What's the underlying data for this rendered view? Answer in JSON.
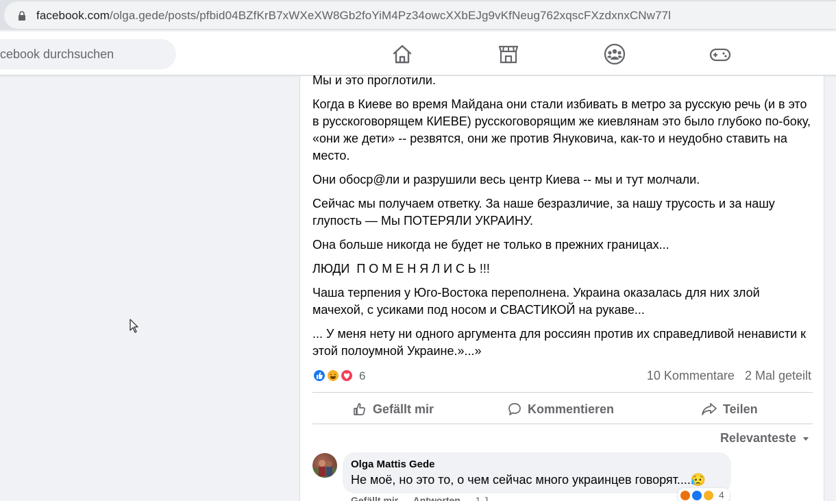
{
  "browser": {
    "url_host": "facebook.com",
    "url_path": "/olga.gede/posts/pfbid04BZfKrB7xWXeXW8Gb2foYiM4Pz34owcXXbEJg9vKfNeug762xqscFXzdxnxCNw77l"
  },
  "header": {
    "search_placeholder": "Facebook durchsuchen",
    "search_visible_text": "cebook durchsuchen",
    "nav": [
      {
        "icon": "home-icon"
      },
      {
        "icon": "marketplace-icon"
      },
      {
        "icon": "groups-icon"
      },
      {
        "icon": "gaming-icon"
      }
    ]
  },
  "post": {
    "paragraphs": [
      "Мы и это проглотили.",
      "Когда в Киеве во время Майдана они стали избивать в метро за русскую речь (и в это в русскоговорящем КИЕВЕ) русскоговорящим же киевлянам это было глубоко по-боку, «они же дети» -- резвятся, они же против Януковича, как-то и неудобно ставить на место.",
      "Они обоср@ли и разрушили весь центр Киева -- мы и тут молчали.",
      "Сейчас мы получаем ответку. За наше безразличие, за нашу трусость и за нашу глупость — Мы ПОТЕРЯЛИ УКРАИНУ.",
      "Она больше никогда не будет не только в прежних границах...",
      "ЛЮДИ  П О М Е Н Я Л И С Ь !!!",
      "Чаша терпения у Юго-Востока переполнена. Украина оказалась для них злой мачехой, с усиками под носом и СВАСТИКОЙ на рукаве...",
      "... У меня нету ни одного аргумента для россиян против их справедливой ненависти к этой полоумной Украине.»...»"
    ],
    "reaction_count": "6",
    "comments_count": "10 Kommentare",
    "shares_count": "2 Mal geteilt",
    "actions": {
      "like": "Gefällt mir",
      "comment": "Kommentieren",
      "share": "Teilen"
    },
    "sort_label": "Relevanteste"
  },
  "comment": {
    "author": "Olga Mattis Gede",
    "text": "Не моё, но это то, о чем сейчас много украинцев говорят....😥",
    "reaction_count": "4",
    "actions": [
      "Gefällt mir",
      "Antworten",
      "1 J"
    ]
  },
  "colors": {
    "fb_blue": "#1877f2",
    "secondary_text": "#65676b",
    "page_bg": "#f0f2f5"
  }
}
